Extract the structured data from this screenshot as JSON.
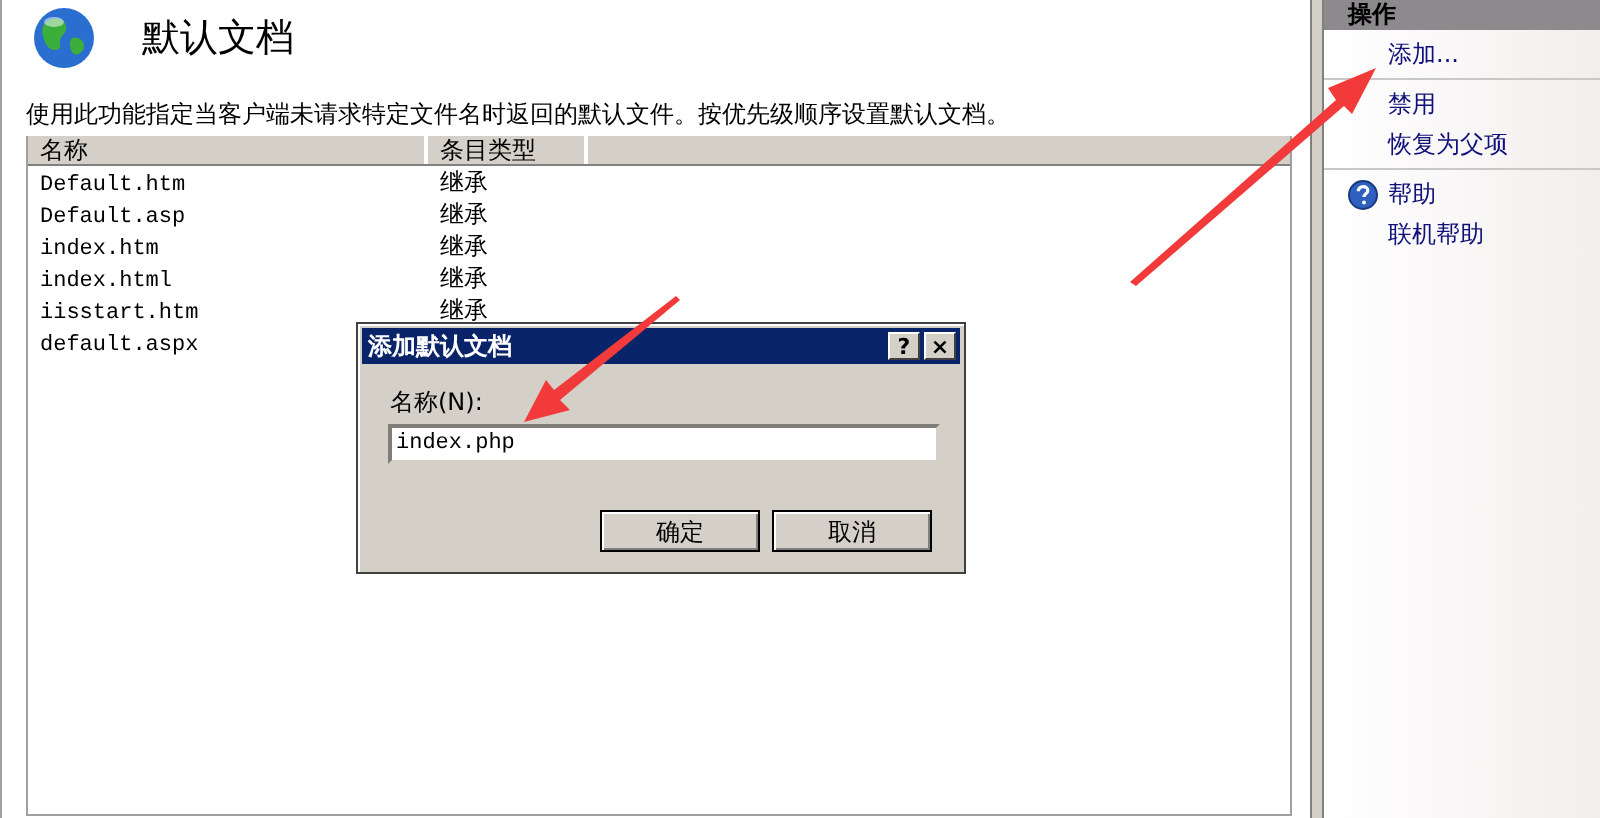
{
  "page": {
    "title": "默认文档",
    "description": "使用此功能指定当客户端未请求特定文件名时返回的默认文件。按优先级顺序设置默认文档。"
  },
  "list": {
    "columns": [
      "名称",
      "条目类型"
    ],
    "rows": [
      {
        "name": "Default.htm",
        "type": "继承"
      },
      {
        "name": "Default.asp",
        "type": "继承"
      },
      {
        "name": "index.htm",
        "type": "继承"
      },
      {
        "name": "index.html",
        "type": "继承"
      },
      {
        "name": "iisstart.htm",
        "type": "继承"
      },
      {
        "name": "default.aspx"
      }
    ]
  },
  "actions": {
    "title": "操作",
    "groups": [
      [
        {
          "label": "添加..."
        }
      ],
      [
        {
          "label": "禁用"
        },
        {
          "label": "恢复为父项"
        }
      ],
      [
        {
          "label": "帮助",
          "kind": "help"
        },
        {
          "label": "联机帮助"
        }
      ]
    ]
  },
  "dialog": {
    "title": "添加默认文档",
    "title_buttons": [
      "?",
      "×"
    ],
    "field_label": "名称(N):",
    "field_value": "index.php",
    "buttons": [
      "确定",
      "取消"
    ]
  }
}
